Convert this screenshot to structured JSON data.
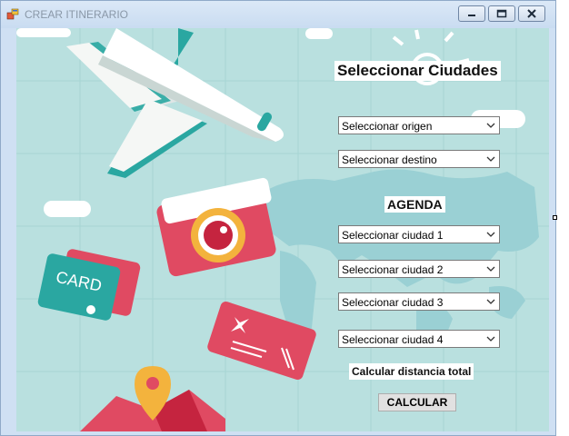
{
  "window": {
    "title": "CREAR ITINERARIO",
    "controls": {
      "minimize_icon": "minimize-icon",
      "maximize_icon": "maximize-icon",
      "close_icon": "close-icon"
    }
  },
  "headings": {
    "cities": "Seleccionar Ciudades",
    "agenda": "AGENDA",
    "distance": "Calcular distancia total"
  },
  "origin": {
    "selected": "Seleccionar origen"
  },
  "destination": {
    "selected": "Seleccionar destino"
  },
  "agenda": {
    "city1": "Seleccionar ciudad 1",
    "city2": "Seleccionar ciudad 2",
    "city3": "Seleccionar  ciudad 3",
    "city4": "Seleccionar ciudad 4"
  },
  "calculate": {
    "label": "CALCULAR"
  },
  "card": {
    "label": "CARD"
  },
  "colors": {
    "background": "#b9e0df",
    "accent_red": "#e04a62",
    "accent_teal": "#2aa7a1"
  }
}
